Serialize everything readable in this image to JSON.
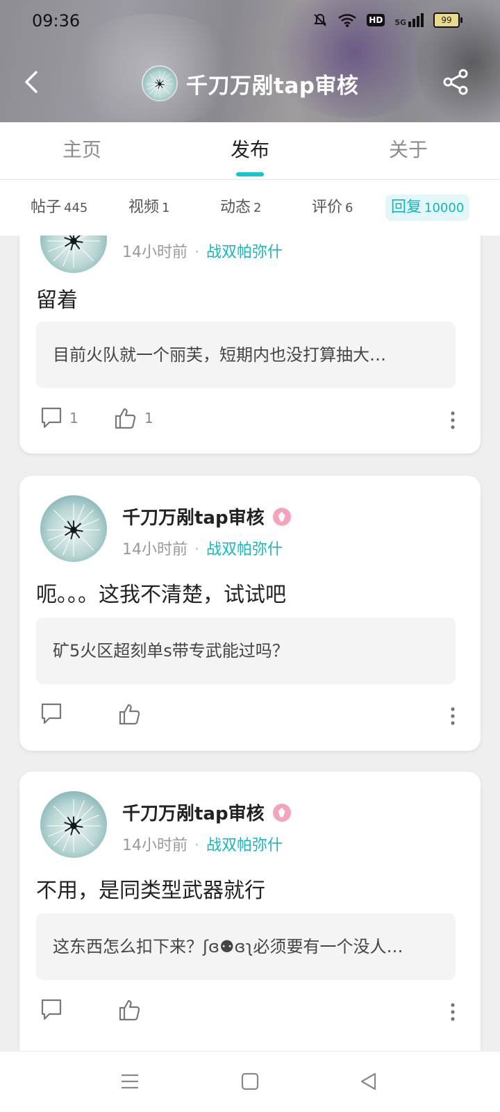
{
  "status_bar": {
    "time": "09:36",
    "hd_label": "HD",
    "network": "5G",
    "battery": "99"
  },
  "header": {
    "title": "千刀万剐tap审核",
    "icons": [
      "back-icon",
      "share-icon"
    ]
  },
  "tabs": [
    {
      "label": "主页",
      "active": false
    },
    {
      "label": "发布",
      "active": true
    },
    {
      "label": "关于",
      "active": false
    }
  ],
  "subtabs": [
    {
      "label": "帖子",
      "count": "445",
      "active": false
    },
    {
      "label": "视频",
      "count": "1",
      "active": false
    },
    {
      "label": "动态",
      "count": "2",
      "active": false
    },
    {
      "label": "评价",
      "count": "6",
      "active": false
    },
    {
      "label": "回复",
      "count": "10000",
      "active": true
    }
  ],
  "posts": [
    {
      "author": "",
      "time": "14小时前",
      "game": "战双帕弥什",
      "content": "留着",
      "quote": "目前火队就一个丽芙，短期内也没打算抽大…",
      "comments": "1",
      "likes": "1"
    },
    {
      "author": "千刀万剐tap审核",
      "time": "14小时前",
      "game": "战双帕弥什",
      "content": "呃。。。这我不清楚，试试吧",
      "quote": "矿5火区超刻单s带专武能过吗？",
      "comments": "",
      "likes": ""
    },
    {
      "author": "千刀万剐tap审核",
      "time": "14小时前",
      "game": "战双帕弥什",
      "content": "不用，是同类型武器就行",
      "quote": "这东西怎么扣下来？ʃɞ⚉ɞʅ必须要有一个没人…",
      "comments": "",
      "likes": ""
    }
  ],
  "colors": {
    "accent": "#15c5ce",
    "accent_text": "#17b6c0",
    "badge": "#f4a3b8"
  }
}
